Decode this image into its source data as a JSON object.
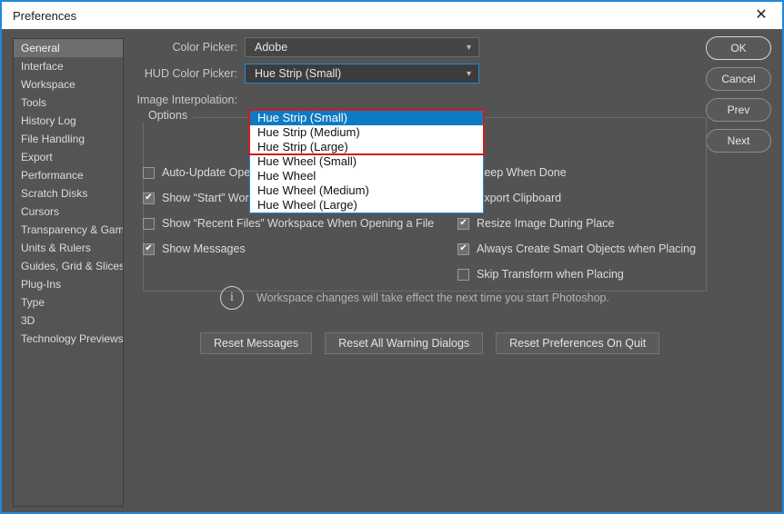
{
  "window": {
    "title": "Preferences",
    "close_icon": "close-icon",
    "accent_color": "#1e8bd6"
  },
  "sidebar": {
    "items": [
      {
        "label": "General",
        "selected": true
      },
      {
        "label": "Interface",
        "selected": false
      },
      {
        "label": "Workspace",
        "selected": false
      },
      {
        "label": "Tools",
        "selected": false
      },
      {
        "label": "History Log",
        "selected": false
      },
      {
        "label": "File Handling",
        "selected": false
      },
      {
        "label": "Export",
        "selected": false
      },
      {
        "label": "Performance",
        "selected": false
      },
      {
        "label": "Scratch Disks",
        "selected": false
      },
      {
        "label": "Cursors",
        "selected": false
      },
      {
        "label": "Transparency & Gamut",
        "selected": false
      },
      {
        "label": "Units & Rulers",
        "selected": false
      },
      {
        "label": "Guides, Grid & Slices",
        "selected": false
      },
      {
        "label": "Plug-Ins",
        "selected": false
      },
      {
        "label": "Type",
        "selected": false
      },
      {
        "label": "3D",
        "selected": false
      },
      {
        "label": "Technology Previews",
        "selected": false
      }
    ]
  },
  "actions": {
    "ok": "OK",
    "cancel": "Cancel",
    "prev": "Prev",
    "next": "Next"
  },
  "fields": {
    "color_picker_label": "Color Picker:",
    "color_picker_value": "Adobe",
    "hud_color_picker_label": "HUD Color Picker:",
    "hud_color_picker_value": "Hue Strip (Small)",
    "image_interpolation_label": "Image Interpolation:",
    "caret_icon": "chevron-down-icon"
  },
  "dropdown": {
    "open": true,
    "highlight_color": "#0d7ac4",
    "marker_color": "#d01b1b",
    "options": [
      {
        "label": "Hue Strip (Small)",
        "highlighted": true
      },
      {
        "label": "Hue Strip (Medium)",
        "highlighted": false
      },
      {
        "label": "Hue Strip (Large)",
        "highlighted": false
      },
      {
        "label": "Hue Wheel (Small)",
        "highlighted": false
      },
      {
        "label": "Hue Wheel",
        "highlighted": false
      },
      {
        "label": "Hue Wheel (Medium)",
        "highlighted": false
      },
      {
        "label": "Hue Wheel (Large)",
        "highlighted": false
      }
    ]
  },
  "options": {
    "legend": "Options",
    "left_column": [
      {
        "label": "Auto-Update Open Documents",
        "checked": false
      },
      {
        "label": "Show “Start” Workspace When No Documents Are Open",
        "checked": true
      },
      {
        "label": "Show “Recent Files” Workspace When Opening a File",
        "checked": false
      },
      {
        "label": "Show Messages",
        "checked": true
      }
    ],
    "right_column": [
      {
        "label": "Beep When Done",
        "checked": false
      },
      {
        "label": "Export Clipboard",
        "checked": false
      },
      {
        "label": "Resize Image During Place",
        "checked": true
      },
      {
        "label": "Always Create Smart Objects when Placing",
        "checked": true
      },
      {
        "label": "Skip Transform when Placing",
        "checked": false
      }
    ],
    "check_glyph": "✔"
  },
  "info": {
    "icon": "info-icon",
    "text": "Workspace changes will take effect the next time you start Photoshop."
  },
  "reset_buttons": [
    {
      "label": "Reset Messages"
    },
    {
      "label": "Reset All Warning Dialogs"
    },
    {
      "label": "Reset Preferences On Quit"
    }
  ]
}
